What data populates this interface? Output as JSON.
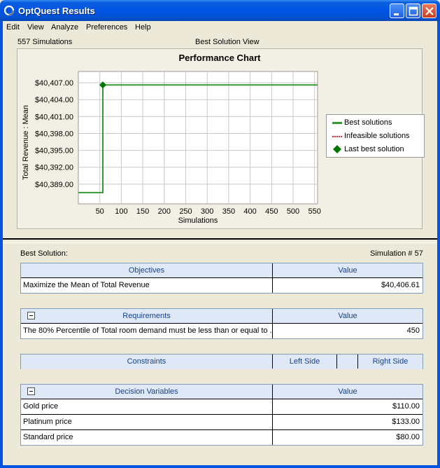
{
  "window": {
    "title": "OptQuest Results"
  },
  "menu": [
    "Edit",
    "View",
    "Analyze",
    "Preferences",
    "Help"
  ],
  "status": {
    "simulations": "557 Simulations",
    "view": "Best Solution View"
  },
  "chart_data": {
    "type": "line",
    "title": "Performance Chart",
    "xlabel": "Simulations",
    "ylabel": "Total Revenue : Mean",
    "x_ticks": [
      "50",
      "100",
      "150",
      "200",
      "250",
      "300",
      "350",
      "400",
      "450",
      "500",
      "550"
    ],
    "y_ticks": [
      "$40,407.00",
      "$40,404.00",
      "$40,401.00",
      "$40,398.00",
      "$40,395.00",
      "$40,392.00",
      "$40,389.00"
    ],
    "ylim": [
      40385.5,
      40409
    ],
    "xlim": [
      0,
      557
    ],
    "grid": true,
    "legend_placement": "right",
    "series": [
      {
        "name": "Best solutions",
        "color": "#339933",
        "points": [
          [
            0,
            40387.5
          ],
          [
            57,
            40387.5
          ],
          [
            57,
            40406.61
          ],
          [
            557,
            40406.61
          ]
        ]
      },
      {
        "name": "Infeasible solutions",
        "color": "#cc3333",
        "points": []
      },
      {
        "name": "Last best solution",
        "color": "#007700",
        "points": [
          [
            57,
            40406.61
          ]
        ]
      }
    ]
  },
  "legend": [
    "Best solutions",
    "Infeasible solutions",
    "Last best solution"
  ],
  "best": {
    "label": "Best Solution:",
    "simulation": "Simulation # 57"
  },
  "objectives": {
    "headers": [
      "Objectives",
      "Value"
    ],
    "rows": [
      [
        "Maximize the Mean of Total Revenue",
        "$40,406.61"
      ]
    ]
  },
  "requirements": {
    "headers": [
      "Requirements",
      "Value"
    ],
    "rows": [
      [
        "The 80% Percentile of Total room demand must be less than or equal to ...",
        "450"
      ]
    ]
  },
  "constraints": {
    "headers": [
      "Constraints",
      "Left Side",
      "Right Side"
    ]
  },
  "decisions": {
    "headers": [
      "Decision Variables",
      "Value"
    ],
    "rows": [
      [
        "Gold price",
        "$110.00"
      ],
      [
        "Platinum price",
        "$133.00"
      ],
      [
        "Standard price",
        "$80.00"
      ]
    ]
  }
}
